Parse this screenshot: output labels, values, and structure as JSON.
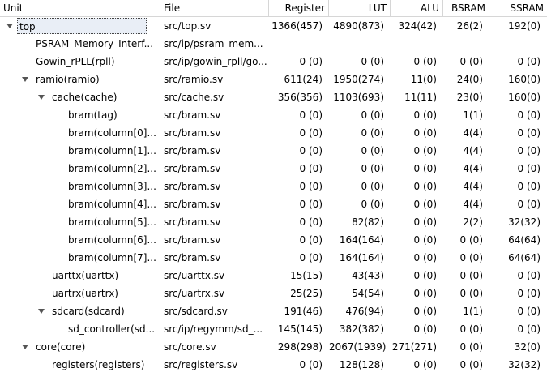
{
  "columns": {
    "unit": "Unit",
    "file": "File",
    "register": "Register",
    "lut": "LUT",
    "alu": "ALU",
    "bsram": "BSRAM",
    "ssram": "SSRAM"
  },
  "rows": [
    {
      "unit": "top",
      "file": "src/top.sv",
      "register": "1366(457)",
      "lut": "4890(873)",
      "alu": "324(42)",
      "bsram": "26(2)",
      "ssram": "192(0)"
    },
    {
      "unit": "PSRAM_Memory_Interf...",
      "file": "src/ip/psram_mem...",
      "register": "",
      "lut": "",
      "alu": "",
      "bsram": "",
      "ssram": ""
    },
    {
      "unit": "Gowin_rPLL(rpll)",
      "file": "src/ip/gowin_rpll/go...",
      "register": "0 (0)",
      "lut": "0 (0)",
      "alu": "0 (0)",
      "bsram": "0 (0)",
      "ssram": "0 (0)"
    },
    {
      "unit": "ramio(ramio)",
      "file": "src/ramio.sv",
      "register": "611(24)",
      "lut": "1950(274)",
      "alu": "11(0)",
      "bsram": "24(0)",
      "ssram": "160(0)"
    },
    {
      "unit": "cache(cache)",
      "file": "src/cache.sv",
      "register": "356(356)",
      "lut": "1103(693)",
      "alu": "11(11)",
      "bsram": "23(0)",
      "ssram": "160(0)"
    },
    {
      "unit": "bram(tag)",
      "file": "src/bram.sv",
      "register": "0 (0)",
      "lut": "0 (0)",
      "alu": "0 (0)",
      "bsram": "1(1)",
      "ssram": "0 (0)"
    },
    {
      "unit": "bram(column[0]...",
      "file": "src/bram.sv",
      "register": "0 (0)",
      "lut": "0 (0)",
      "alu": "0 (0)",
      "bsram": "4(4)",
      "ssram": "0 (0)"
    },
    {
      "unit": "bram(column[1]...",
      "file": "src/bram.sv",
      "register": "0 (0)",
      "lut": "0 (0)",
      "alu": "0 (0)",
      "bsram": "4(4)",
      "ssram": "0 (0)"
    },
    {
      "unit": "bram(column[2]...",
      "file": "src/bram.sv",
      "register": "0 (0)",
      "lut": "0 (0)",
      "alu": "0 (0)",
      "bsram": "4(4)",
      "ssram": "0 (0)"
    },
    {
      "unit": "bram(column[3]...",
      "file": "src/bram.sv",
      "register": "0 (0)",
      "lut": "0 (0)",
      "alu": "0 (0)",
      "bsram": "4(4)",
      "ssram": "0 (0)"
    },
    {
      "unit": "bram(column[4]...",
      "file": "src/bram.sv",
      "register": "0 (0)",
      "lut": "0 (0)",
      "alu": "0 (0)",
      "bsram": "4(4)",
      "ssram": "0 (0)"
    },
    {
      "unit": "bram(column[5]...",
      "file": "src/bram.sv",
      "register": "0 (0)",
      "lut": "82(82)",
      "alu": "0 (0)",
      "bsram": "2(2)",
      "ssram": "32(32)"
    },
    {
      "unit": "bram(column[6]...",
      "file": "src/bram.sv",
      "register": "0 (0)",
      "lut": "164(164)",
      "alu": "0 (0)",
      "bsram": "0 (0)",
      "ssram": "64(64)"
    },
    {
      "unit": "bram(column[7]...",
      "file": "src/bram.sv",
      "register": "0 (0)",
      "lut": "164(164)",
      "alu": "0 (0)",
      "bsram": "0 (0)",
      "ssram": "64(64)"
    },
    {
      "unit": "uarttx(uarttx)",
      "file": "src/uarttx.sv",
      "register": "15(15)",
      "lut": "43(43)",
      "alu": "0 (0)",
      "bsram": "0 (0)",
      "ssram": "0 (0)"
    },
    {
      "unit": "uartrx(uartrx)",
      "file": "src/uartrx.sv",
      "register": "25(25)",
      "lut": "54(54)",
      "alu": "0 (0)",
      "bsram": "0 (0)",
      "ssram": "0 (0)"
    },
    {
      "unit": "sdcard(sdcard)",
      "file": "src/sdcard.sv",
      "register": "191(46)",
      "lut": "476(94)",
      "alu": "0 (0)",
      "bsram": "1(1)",
      "ssram": "0 (0)"
    },
    {
      "unit": "sd_controller(sd...",
      "file": "src/ip/regymm/sd_...",
      "register": "145(145)",
      "lut": "382(382)",
      "alu": "0 (0)",
      "bsram": "0 (0)",
      "ssram": "0 (0)"
    },
    {
      "unit": "core(core)",
      "file": "src/core.sv",
      "register": "298(298)",
      "lut": "2067(1939)",
      "alu": "271(271)",
      "bsram": "0 (0)",
      "ssram": "32(0)"
    },
    {
      "unit": "registers(registers)",
      "file": "src/registers.sv",
      "register": "0 (0)",
      "lut": "128(128)",
      "alu": "0 (0)",
      "bsram": "0 (0)",
      "ssram": "32(32)"
    }
  ]
}
